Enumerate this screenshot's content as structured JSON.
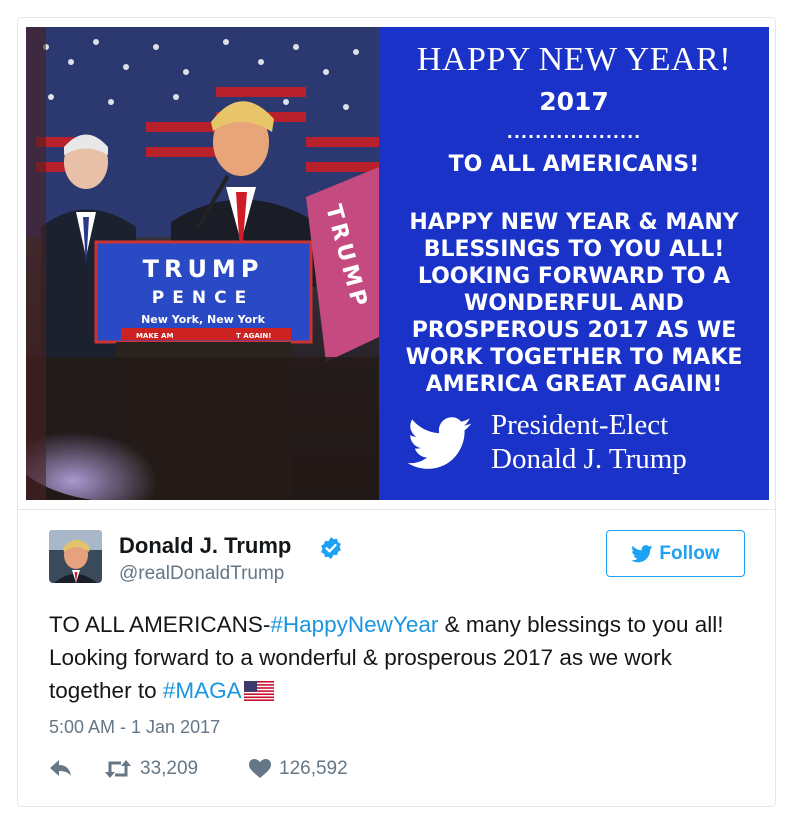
{
  "image_panel": {
    "podium_name": "TRUMP",
    "podium_running_mate": "PENCE",
    "podium_location": "New York, New York",
    "podium_slogan_left": "MAKE AM",
    "podium_slogan_right": "T AGAIN!",
    "sign_text": "TRUMP",
    "title": "HAPPY NEW YEAR!",
    "year": "2017",
    "dots": "...................",
    "heading": "TO ALL AMERICANS!",
    "body": "HAPPY NEW YEAR & MANY\nBLESSINGS TO YOU ALL!\nLOOKING FORWARD TO A\nWONDERFUL AND\nPROSPEROUS 2017 AS WE\nWORK TOGETHER TO MAKE\nAMERICA GREAT AGAIN!",
    "signature_line1": "President-Elect",
    "signature_line2": "Donald J. Trump",
    "panel_color": "#1a32c8"
  },
  "tweet": {
    "author_name": "Donald J. Trump",
    "handle": "@realDonaldTrump",
    "follow_label": "Follow",
    "text_part1": "TO ALL AMERICANS-",
    "hashtag1": "#HappyNewYear",
    "text_part2": " & many blessings to you all! Looking forward to a wonderful & prosperous 2017 as we work together to ",
    "hashtag2": "#MAGA",
    "timestamp": "5:00 AM - 1 Jan 2017",
    "retweets": "33,209",
    "likes": "126,592",
    "accent_color": "#1da1f2",
    "link_color": "#1b95e0",
    "icons": [
      "reply-icon",
      "retweet-icon",
      "heart-icon",
      "twitter-bird-icon",
      "verified-badge-icon",
      "us-flag-icon"
    ]
  }
}
